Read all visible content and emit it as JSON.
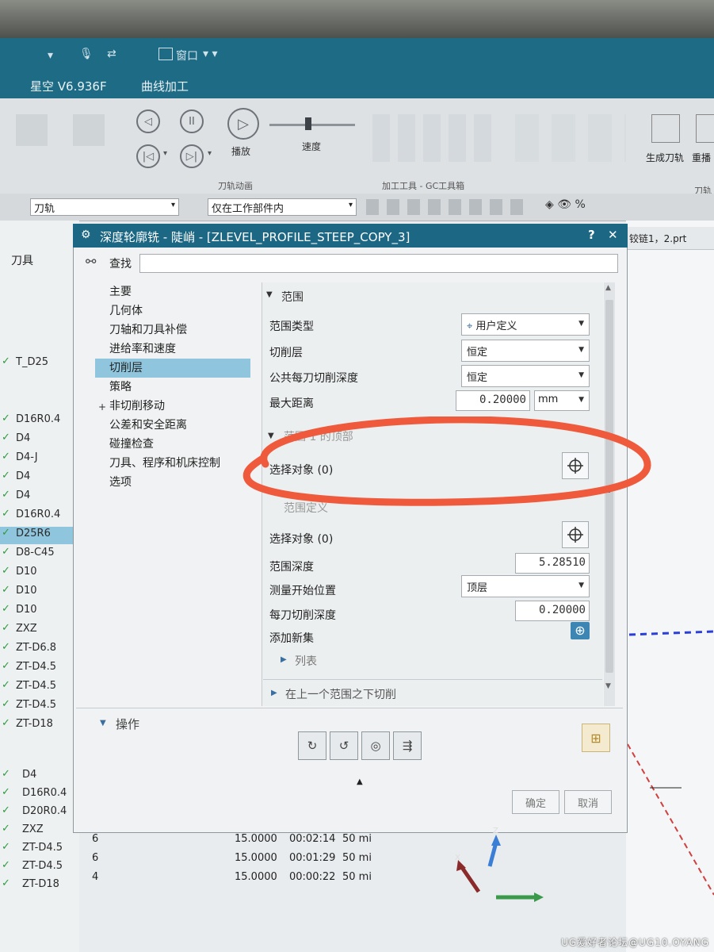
{
  "window": {
    "menu_window": "窗口",
    "app_title": "星空 V6.936F",
    "tab_curve": "曲线加工"
  },
  "ribbon": {
    "play_label": "播放",
    "speed_label": "速度",
    "group_animation": "刀轨动画",
    "group_tools": "加工工具 - GC工具箱",
    "generate_label": "生成刀轨",
    "replay_label": "重播",
    "right_group": "刀轨"
  },
  "toolbar2": {
    "filter_value": "刀轨",
    "scope_value": "仅在工作部件内",
    "part_tab": "铰链1，2.prt"
  },
  "nav": {
    "header": "刀具",
    "tools": [
      "T_D25",
      "D16R0.4",
      "D4",
      "D4-J",
      "D4",
      "D4",
      "D16R0.4",
      "D25R6",
      "D8-C45",
      "D10",
      "D10",
      "D10",
      "ZXZ",
      "ZT-D6.8",
      "ZT-D4.5",
      "ZT-D4.5",
      "ZT-D4.5",
      "ZT-D18"
    ],
    "tools_bottom": [
      "D4",
      "D16R0.4",
      "D20R0.4",
      "ZXZ",
      "ZT-D4.5",
      "ZT-D4.5",
      "ZT-D18"
    ]
  },
  "dialog": {
    "title": "深度轮廓铣 - 陡峭 - [ZLEVEL_PROFILE_STEEP_COPY_3]",
    "help": "?",
    "close": "✕",
    "find_label": "查找",
    "tree": [
      "主要",
      "几何体",
      "刀轴和刀具补偿",
      "进给率和速度",
      "切削层",
      "策略",
      "非切削移动",
      "公差和安全距离",
      "碰撞检查",
      "刀具、程序和机床控制",
      "选项"
    ],
    "tree_plus": "+",
    "section_range": "范围",
    "range_type_label": "范围类型",
    "range_type_value": "用户定义",
    "cut_levels_label": "切削层",
    "cut_levels_value": "恒定",
    "common_depth_label": "公共每刀切削深度",
    "common_depth_value": "恒定",
    "max_distance_label": "最大距离",
    "max_distance_value": "0.20000",
    "max_distance_unit": "mm",
    "section_top": "范围 1 的顶部",
    "select_object_1": "选择对象 (0)",
    "section_range_def": "范围定义",
    "select_object_2": "选择对象 (0)",
    "range_depth_label": "范围深度",
    "range_depth_value": "5.28510",
    "measure_start_label": "测量开始位置",
    "measure_start_value": "顶层",
    "per_cut_depth_label": "每刀切削深度",
    "per_cut_depth_value": "0.20000",
    "add_set_label": "添加新集",
    "list_label": "列表",
    "below_label": "在上一个范围之下切削",
    "operations_label": "操作",
    "ok_button": "确定",
    "cancel_button": "取消"
  },
  "time_table": [
    {
      "a": "6",
      "b": "15.0000",
      "c": "00:02:14",
      "d": "50 mi"
    },
    {
      "a": "6",
      "b": "15.0000",
      "c": "00:01:29",
      "d": "50 mi"
    },
    {
      "a": "4",
      "b": "15.0000",
      "c": "00:00:22",
      "d": "50 mi"
    }
  ],
  "axes": {
    "x": "X",
    "z": "Z"
  },
  "watermark": "UG爱好者论坛@UG10.OYANG",
  "colors": {
    "title_bar": "#1c6784",
    "selected": "#8fc6de",
    "annotation": "#f05a3c",
    "check": "#2e9a3d"
  }
}
